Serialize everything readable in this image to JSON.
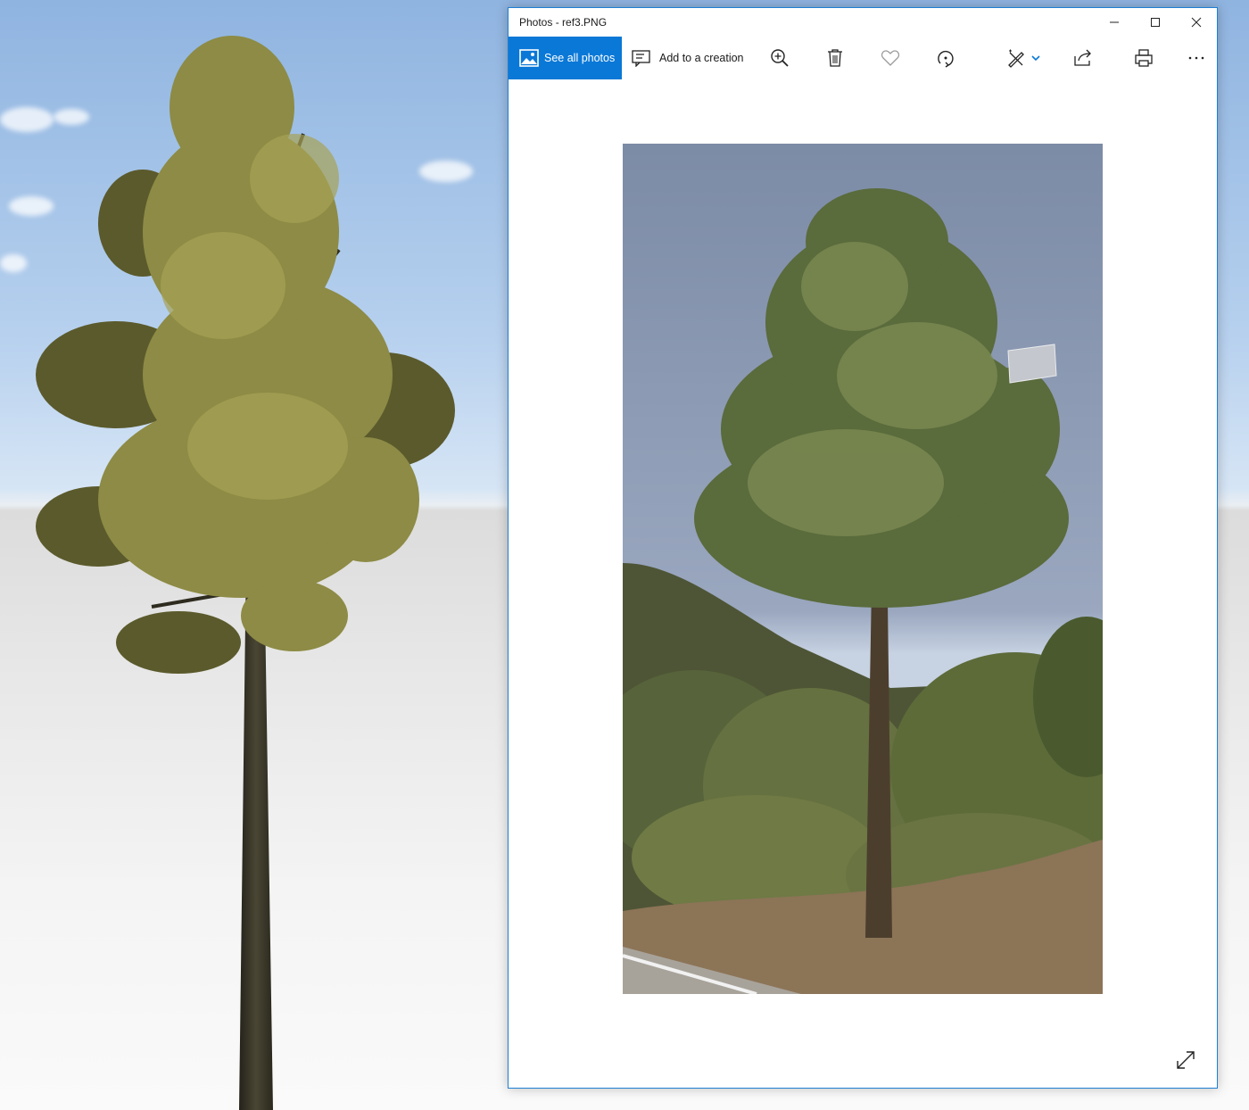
{
  "window": {
    "title": "Photos - ref3.PNG",
    "accent_color": "#0a78d7"
  },
  "caption_buttons": [
    "minimize-icon",
    "maximize-icon",
    "close-icon"
  ],
  "toolbar": {
    "see_all_label": "See all photos",
    "add_creation_label": "Add to a creation",
    "icons": [
      "zoom-in-icon",
      "delete-icon",
      "favorite-heart-icon",
      "rotate-icon",
      "edit-draw-icon",
      "share-icon",
      "print-icon",
      "more-icon"
    ]
  },
  "footer": {
    "icon": "fullscreen-expand-icon"
  },
  "colors": {
    "sky_top": "#8fb4e0",
    "ground": "#e7e7e7",
    "foliage": "#8a8a3e",
    "trunk": "#3a3626"
  }
}
